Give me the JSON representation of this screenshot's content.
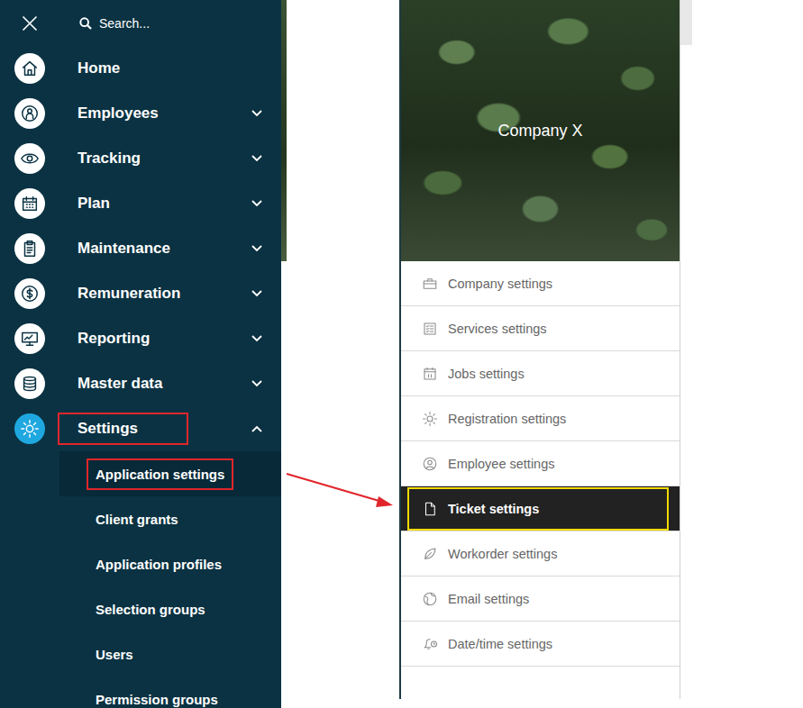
{
  "nav": {
    "search": {
      "placeholder": "Search..."
    },
    "items": [
      {
        "label": "Home",
        "kind": "link",
        "expanded": false,
        "selected": false,
        "annotated": false
      },
      {
        "label": "Employees",
        "kind": "group",
        "expanded": false,
        "selected": false,
        "annotated": false
      },
      {
        "label": "Tracking",
        "kind": "group",
        "expanded": false,
        "selected": false,
        "annotated": false
      },
      {
        "label": "Plan",
        "kind": "group",
        "expanded": false,
        "selected": false,
        "annotated": false
      },
      {
        "label": "Maintenance",
        "kind": "group",
        "expanded": false,
        "selected": false,
        "annotated": false
      },
      {
        "label": "Remuneration",
        "kind": "group",
        "expanded": false,
        "selected": false,
        "annotated": false
      },
      {
        "label": "Reporting",
        "kind": "group",
        "expanded": false,
        "selected": false,
        "annotated": false
      },
      {
        "label": "Master data",
        "kind": "group",
        "expanded": false,
        "selected": false,
        "annotated": false
      },
      {
        "label": "Settings",
        "kind": "group",
        "expanded": true,
        "selected": true,
        "annotated": true
      }
    ],
    "subitems": [
      {
        "label": "Application settings",
        "selected": true,
        "annotated": true
      },
      {
        "label": "Client grants",
        "selected": false,
        "annotated": false
      },
      {
        "label": "Application profiles",
        "selected": false,
        "annotated": false
      },
      {
        "label": "Selection groups",
        "selected": false,
        "annotated": false
      },
      {
        "label": "Users",
        "selected": false,
        "annotated": false
      },
      {
        "label": "Permission groups",
        "selected": false,
        "annotated": false
      }
    ]
  },
  "settings_panel": {
    "company": "Company X",
    "items": [
      {
        "label": "Company settings",
        "selected": false,
        "annotated": false
      },
      {
        "label": "Services settings",
        "selected": false,
        "annotated": false
      },
      {
        "label": "Jobs settings",
        "selected": false,
        "annotated": false
      },
      {
        "label": "Registration settings",
        "selected": false,
        "annotated": false
      },
      {
        "label": "Employee settings",
        "selected": false,
        "annotated": false
      },
      {
        "label": "Ticket settings",
        "selected": true,
        "annotated": true
      },
      {
        "label": "Workorder settings",
        "selected": false,
        "annotated": false
      },
      {
        "label": "Email settings",
        "selected": false,
        "annotated": false
      },
      {
        "label": "Date/time settings",
        "selected": false,
        "annotated": false
      }
    ]
  }
}
